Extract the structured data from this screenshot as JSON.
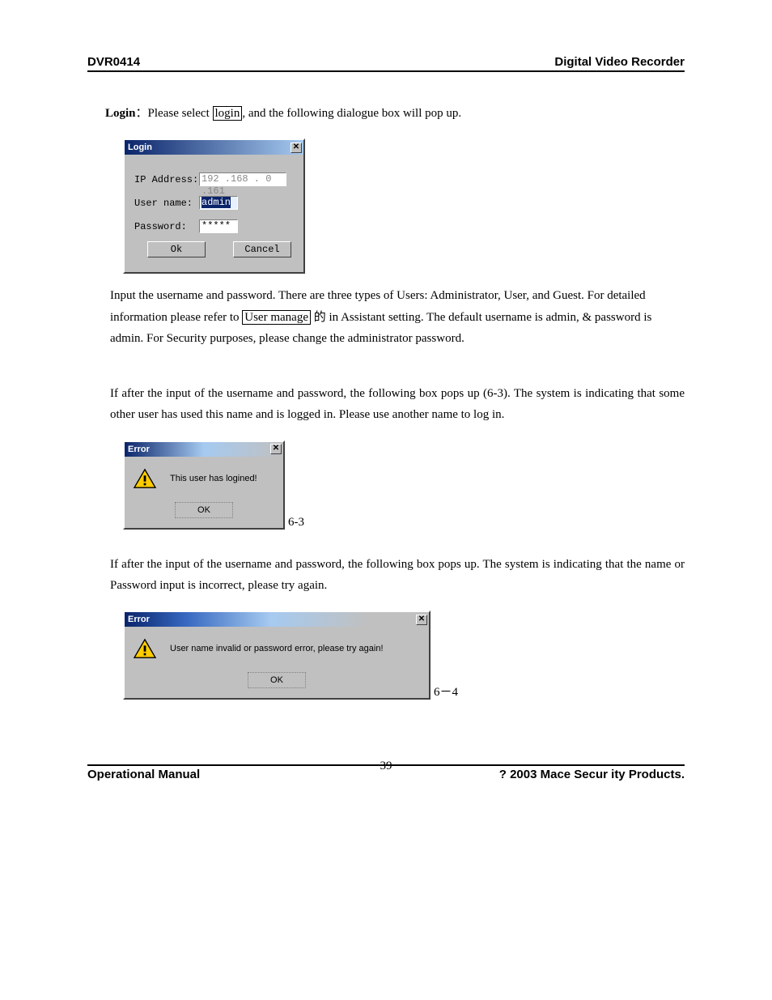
{
  "header": {
    "left": "DVR0414",
    "right": "Digital Video Recorder"
  },
  "intro": {
    "login_label": "Login",
    "colon": "：",
    "pre": "Please select ",
    "boxed": "login",
    "post": ", and the following dialogue box will pop up."
  },
  "login_dlg": {
    "title": "Login",
    "ip_label": "IP Address:",
    "ip_value": "192 .168 . 0  .161",
    "user_label": "User name:",
    "user_value": "admin",
    "pwd_label": "Password:",
    "pwd_value": "*****",
    "ok": "Ok",
    "cancel": "Cancel"
  },
  "para1": {
    "pre": "Input the username and password. There are three types of Users: Administrator, User, and Guest. For detailed information please refer to ",
    "boxed": "User manage",
    "tail": " 的 in Assistant setting. The default username is admin, & password is admin. For Security purposes, please change the administrator password."
  },
  "para2": "If after the input of the username and password, the following box pops up (6-3). The system is indicating that some other user has used this name and is logged in. Please use another name to log in.",
  "err1": {
    "title": "Error",
    "msg": "This user has logined!",
    "ok": "OK",
    "caption": "6-3"
  },
  "para3": "If after the input of the username and password, the following box pops up. The system is indicating that the name or Password input is incorrect,   please try again.",
  "err2": {
    "title": "Error",
    "msg": "User name invalid or password error, please try again!",
    "ok": "OK",
    "caption": "6－4"
  },
  "footer": {
    "left": "Operational Manual",
    "center": "39",
    "right": "? 2003 Mace Secur ity Products."
  }
}
